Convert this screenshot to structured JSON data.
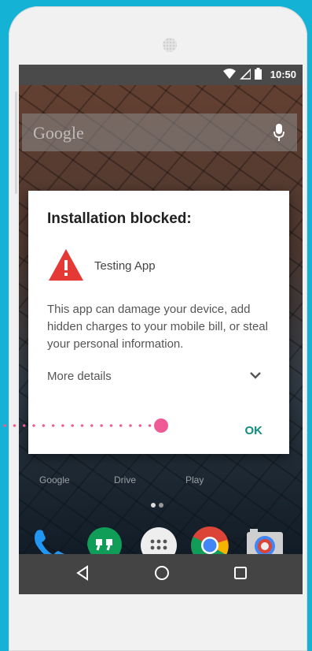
{
  "status_bar": {
    "time": "10:50",
    "icons": [
      "wifi-icon",
      "signal-icon",
      "battery-icon"
    ]
  },
  "search_bar": {
    "label": "Google",
    "icon": "mic-icon"
  },
  "home_labels": [
    "Google",
    "Drive",
    "Play"
  ],
  "dock_apps": [
    "phone-icon",
    "hangouts-icon",
    "app-drawer-icon",
    "chrome-icon",
    "camera-icon"
  ],
  "nav_bar": [
    "back-icon",
    "home-icon",
    "recents-icon"
  ],
  "dialog": {
    "title": "Installation blocked:",
    "app_name": "Testing App",
    "message": "This app can damage your device, add hidden charges to your mobile bill, or steal your personal information.",
    "more_details": "More details",
    "ok_label": "OK",
    "warning_icon": "warning-icon",
    "chevron_icon": "chevron-down-icon"
  },
  "colors": {
    "background": "#14b3d6",
    "accent": "#128c7e",
    "warning": "#e53935",
    "pointer": "#ef5b94"
  }
}
